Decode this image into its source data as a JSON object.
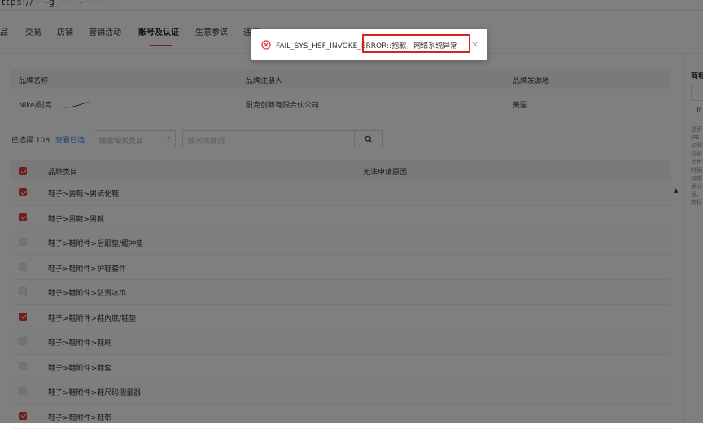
{
  "browser": {
    "url_fragment": "ttps://···-g_··· ·-··· ··· _"
  },
  "nav": {
    "items": [
      "品",
      "交易",
      "店铺",
      "营销活动",
      "账号及认证",
      "生意参谋",
      "违规"
    ],
    "active_index": 4,
    "accent_color": "#e4393c"
  },
  "brand_table": {
    "headers": [
      "品牌名称",
      "品牌注册人",
      "品牌发源地"
    ],
    "row": {
      "name": "Nike/耐克",
      "registrant": "耐克创新有限合伙公司",
      "origin": "美国"
    }
  },
  "filter": {
    "selected_label": "已选择 108",
    "view_selected": "查看已选",
    "category_placeholder": "搜索相关类目",
    "keyword_placeholder": "搜索关键词"
  },
  "category_table": {
    "headers": [
      "品牌类目",
      "无法申请原因"
    ],
    "rows": [
      {
        "label": "鞋子>男鞋>男硫化鞋",
        "checked": true
      },
      {
        "label": "鞋子>男鞋>男靴",
        "checked": true
      },
      {
        "label": "鞋子>鞋附件>后跟垫/缓冲垫",
        "checked": false
      },
      {
        "label": "鞋子>鞋附件>护鞋套件",
        "checked": false
      },
      {
        "label": "鞋子>鞋附件>防滑冰爪",
        "checked": false
      },
      {
        "label": "鞋子>鞋附件>鞋内底/鞋垫",
        "checked": true
      },
      {
        "label": "鞋子>鞋附件>鞋刷",
        "checked": false
      },
      {
        "label": "鞋子>鞋附件>鞋套",
        "checked": false
      },
      {
        "label": "鞋子>鞋附件>鞋尺码测量器",
        "checked": false
      },
      {
        "label": "鞋子>鞋附件>鞋带",
        "checked": true
      }
    ]
  },
  "right_panel": {
    "title": "商标",
    "tr": "Tr",
    "text": "是否JPE权利注册销售时确权部确认理。商标"
  },
  "toast": {
    "message": "FAIL_SYS_HSF_INVOKE_ERROR::抱歉，网络系统异常",
    "error_color": "#e4393c",
    "highlight_color": "#e02020"
  }
}
